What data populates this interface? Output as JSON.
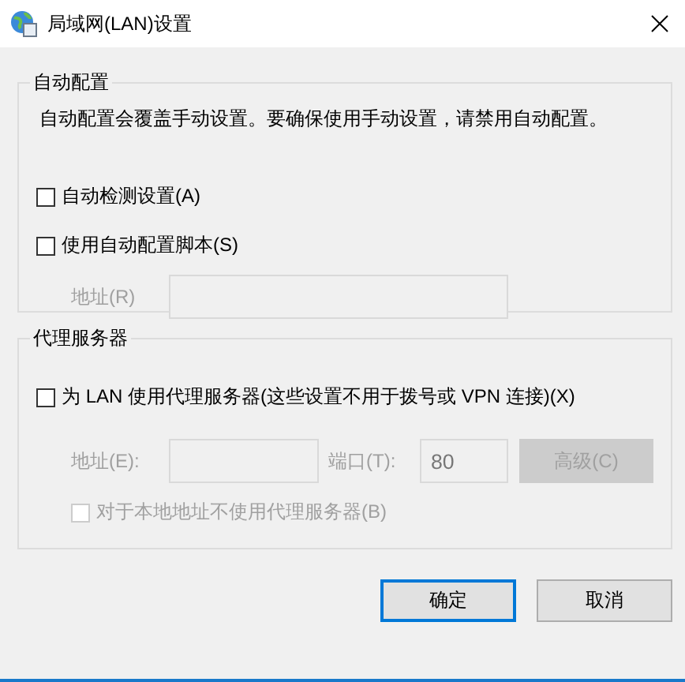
{
  "window": {
    "title": "局域网(LAN)设置"
  },
  "auto_config": {
    "title": "自动配置",
    "description": "自动配置会覆盖手动设置。要确保使用手动设置，请禁用自动配置。",
    "options": [
      {
        "label": "自动检测设置(A)",
        "checked": false
      },
      {
        "label": "使用自动配置脚本(S)",
        "checked": false
      }
    ],
    "address": {
      "label": "地址(R)",
      "disabled": true
    }
  },
  "proxy": {
    "title": "代理服务器",
    "use_proxy": {
      "label": "为 LAN 使用代理服务器(这些设置不用于拨号或 VPN 连接)(X)",
      "checked": false
    },
    "address": {
      "label": "地址(E):",
      "disabled": true
    },
    "port": {
      "label": "端口(T):",
      "value": "80",
      "disabled": true
    },
    "advanced": {
      "label": "高级(C)",
      "disabled": true
    },
    "bypass_local": {
      "label": "对于本地地址不使用代理服务器(B)",
      "checked": false,
      "disabled": true
    }
  },
  "buttons": [
    {
      "label": "确定",
      "default": true
    },
    {
      "label": "取消",
      "default": false
    }
  ]
}
